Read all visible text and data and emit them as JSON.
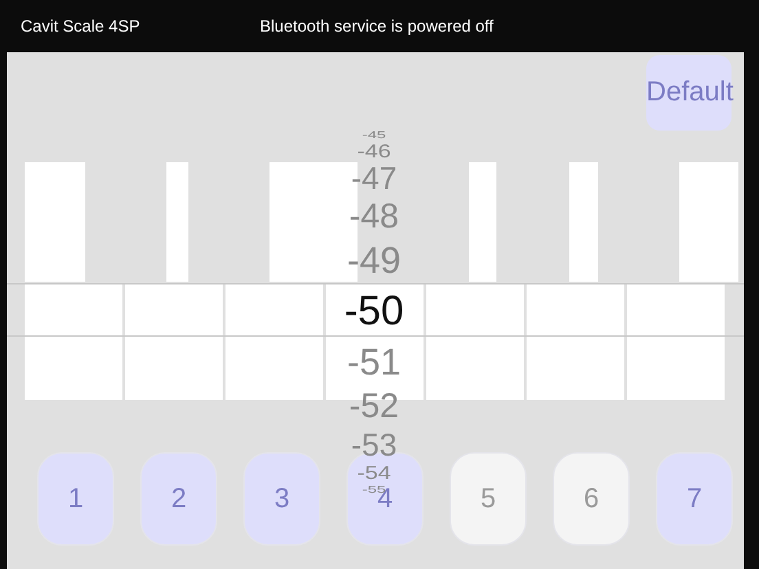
{
  "header": {
    "title": "Cavit Scale 4SP",
    "status": "Bluetooth service is powered off"
  },
  "default_button": {
    "label": "Default"
  },
  "picker": {
    "items": [
      {
        "label": "-45",
        "selected": false
      },
      {
        "label": "-46",
        "selected": false
      },
      {
        "label": "-47",
        "selected": false
      },
      {
        "label": "-48",
        "selected": false
      },
      {
        "label": "-49",
        "selected": false
      },
      {
        "label": "-50",
        "selected": true
      },
      {
        "label": "-51",
        "selected": false
      },
      {
        "label": "-52",
        "selected": false
      },
      {
        "label": "-53",
        "selected": false
      },
      {
        "label": "-54",
        "selected": false
      },
      {
        "label": "-55",
        "selected": false
      }
    ]
  },
  "channel_buttons": [
    {
      "label": "1",
      "selected": true
    },
    {
      "label": "2",
      "selected": true
    },
    {
      "label": "3",
      "selected": true
    },
    {
      "label": "4",
      "selected": true
    },
    {
      "label": "5",
      "selected": false
    },
    {
      "label": "6",
      "selected": false
    },
    {
      "label": "7",
      "selected": true
    }
  ]
}
